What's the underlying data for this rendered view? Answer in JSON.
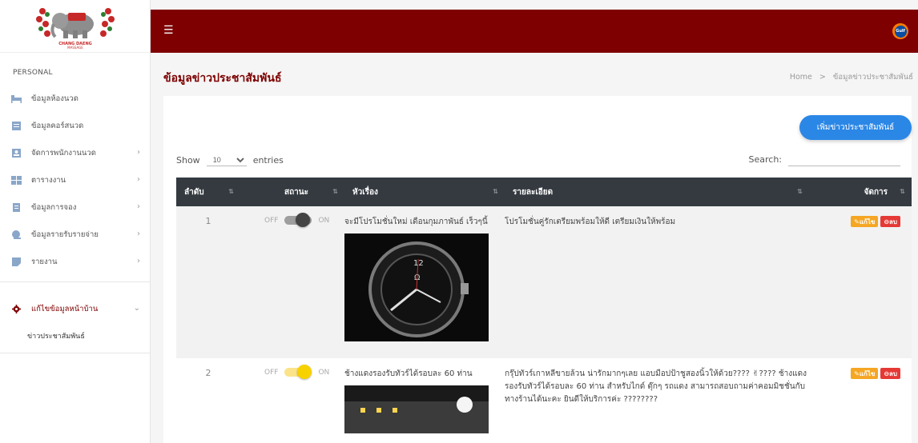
{
  "sidebar": {
    "section_label": "PERSONAL",
    "items": [
      {
        "label": "ข้อมูลห้องนวด",
        "icon": "bed-icon",
        "chevron": false
      },
      {
        "label": "ข้อมูลคอร์สนวด",
        "icon": "list-icon",
        "chevron": false
      },
      {
        "label": "จัดการพนักงานนวด",
        "icon": "user-card-icon",
        "chevron": true
      },
      {
        "label": "ตารางงาน",
        "icon": "table-icon",
        "chevron": true
      },
      {
        "label": "ข้อมูลการจอง",
        "icon": "document-icon",
        "chevron": true
      },
      {
        "label": "ข้อมูลรายรับรายจ่าย",
        "icon": "money-icon",
        "chevron": true
      },
      {
        "label": "รายงาน",
        "icon": "report-icon",
        "chevron": true
      }
    ],
    "settings_label": "แก้ไขข้อมูลหน้าบ้าน",
    "submenu_label": "ข่าวประชาสัมพันธ์",
    "logo_text": "CHANG DAENG MASSAGE"
  },
  "topbar": {
    "brand_badge": "Gulf"
  },
  "page": {
    "title": "ข้อมูลข่าวประชาสัมพันธ์",
    "breadcrumb_home": "Home",
    "breadcrumb_sep": ">",
    "breadcrumb_current": "ข้อมูลข่าวประชาสัมพันธ์"
  },
  "toolbar": {
    "add_button": "เพิ่มข่าวประชาสัมพันธ์",
    "show_label": "Show",
    "entries_value": "10",
    "entries_label": "entries",
    "search_label": "Search:"
  },
  "table": {
    "headers": [
      "ลำดับ",
      "สถานะ",
      "หัวเรื่อง",
      "รายละเอียด",
      "จัดการ"
    ],
    "rows": [
      {
        "num": "1",
        "off": "OFF",
        "on": "ON",
        "status_on": false,
        "title": "จะมีโปรโมชั่นใหม่ เดือนกุมภาพันธ์ เร็วๆนี้",
        "detail": "โปรโมชั่นคู่รักเตรียมพร้อมให้ดี เตรียมเงินให้พร้อม",
        "edit": "แก้ไข",
        "delete": "ลบ"
      },
      {
        "num": "2",
        "off": "OFF",
        "on": "ON",
        "status_on": true,
        "title": "ช้างแดงรองรับทัวร์ได้รอบละ 60 ท่าน",
        "detail": "กรุ๊ปทัวร์เกาหลีขายล้วน น่ารักมากๆเลย แอบมือปป้าชูสองนิ้วให้ด้วย???? ✌???? ช้างแดงรองรับทัวร์ได้รอบละ 60 ท่าน สำหรับไกด์ ตุ๊กๆ รถแดง สามารถสอบถามค่าคอมมิชชั่นกับทางร้านได้นะคะ ยินดีให้บริการค่ะ ????????",
        "edit": "แก้ไข",
        "delete": "ลบ"
      }
    ]
  },
  "colors": {
    "brand": "#7e0000",
    "accent": "#2b87e6",
    "table_header": "#343a40",
    "edit": "#f5a623",
    "delete": "#e53935",
    "toggle_on": "#f7d100"
  }
}
